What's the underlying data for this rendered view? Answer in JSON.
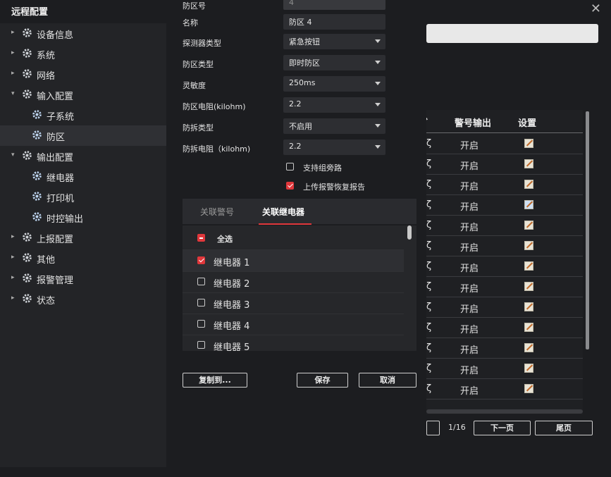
{
  "window": {
    "title": "远程配置"
  },
  "sidebar": {
    "items": [
      {
        "label": "设备信息",
        "level": 0,
        "expanded": false
      },
      {
        "label": "系统",
        "level": 0,
        "expanded": false
      },
      {
        "label": "网络",
        "level": 0,
        "expanded": false
      },
      {
        "label": "输入配置",
        "level": 0,
        "expanded": true
      },
      {
        "label": "子系统",
        "level": 1
      },
      {
        "label": "防区",
        "level": 1,
        "selected": true
      },
      {
        "label": "输出配置",
        "level": 0,
        "expanded": true
      },
      {
        "label": "继电器",
        "level": 1
      },
      {
        "label": "打印机",
        "level": 1
      },
      {
        "label": "时控输出",
        "level": 1
      },
      {
        "label": "上报配置",
        "level": 0,
        "expanded": false
      },
      {
        "label": "其他",
        "level": 0,
        "expanded": false
      },
      {
        "label": "报警管理",
        "level": 0,
        "expanded": false
      },
      {
        "label": "状态",
        "level": 0,
        "expanded": false
      }
    ]
  },
  "form": {
    "zone_no": {
      "label": "防区号",
      "value": "4"
    },
    "name": {
      "label": "名称",
      "value": "防区 4"
    },
    "detector_type": {
      "label": "探测器类型",
      "value": "紧急按钮"
    },
    "zone_type": {
      "label": "防区类型",
      "value": "即时防区"
    },
    "sensitivity": {
      "label": "灵敏度",
      "value": "250ms"
    },
    "zone_resistor": {
      "label": "防区电阻(kilohm)",
      "value": "2.2"
    },
    "tamper_type": {
      "label": "防拆类型",
      "value": "不启用"
    },
    "tamper_resistor": {
      "label": "防拆电阻（kilohm)",
      "value": "2.2"
    },
    "support_group_bypass": {
      "label": "支持组旁路",
      "checked": false
    },
    "upload_restore_report": {
      "label": "上传报警恢复报告",
      "checked": true
    }
  },
  "tabs": [
    {
      "label": "关联警号",
      "active": false
    },
    {
      "label": "关联继电器",
      "active": true
    }
  ],
  "relays": {
    "select_all": "全选",
    "items": [
      {
        "label": "继电器 1",
        "checked": true
      },
      {
        "label": "继电器 2",
        "checked": false
      },
      {
        "label": "继电器 3",
        "checked": false
      },
      {
        "label": "继电器 4",
        "checked": false
      },
      {
        "label": "继电器 5",
        "checked": false
      }
    ]
  },
  "buttons": {
    "copy_to": "复制到...",
    "save": "保存",
    "cancel": "取消"
  },
  "zone_table": {
    "headers": {
      "siren_output": "警号输出",
      "settings": "设置"
    },
    "clipped_header": "",
    "rows": [
      {
        "stub": "ζ",
        "siren": "开启"
      },
      {
        "stub": "ζ",
        "siren": "开启"
      },
      {
        "stub": "ζ",
        "siren": "开启"
      },
      {
        "stub": "ζ",
        "siren": "开启"
      },
      {
        "stub": "ζ",
        "siren": "开启"
      },
      {
        "stub": "ζ",
        "siren": "开启"
      },
      {
        "stub": "ζ",
        "siren": "开启"
      },
      {
        "stub": "ζ",
        "siren": "开启"
      },
      {
        "stub": "ζ",
        "siren": "开启"
      },
      {
        "stub": "ζ",
        "siren": "开启"
      },
      {
        "stub": "ζ",
        "siren": "开启"
      },
      {
        "stub": "ζ",
        "siren": "开启"
      },
      {
        "stub": "ζ",
        "siren": "开启"
      }
    ]
  },
  "pager": {
    "page": "1/16",
    "next": "下一页",
    "last": "尾页"
  }
}
